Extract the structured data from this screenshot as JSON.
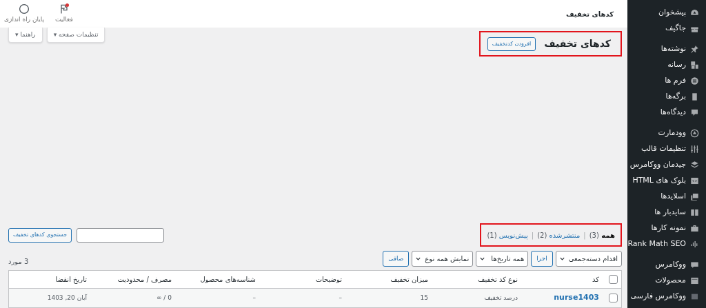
{
  "sidebar": {
    "groups": [
      [
        {
          "label": "پیشخوان"
        },
        {
          "label": "جاگیف"
        }
      ],
      [
        {
          "label": "نوشته‌ها"
        },
        {
          "label": "رسانه"
        },
        {
          "label": "فرم ها"
        },
        {
          "label": "برگه‌ها"
        },
        {
          "label": "دیدگاه‌ها"
        }
      ],
      [
        {
          "label": "وودمارت"
        },
        {
          "label": "تنظیمات قالب"
        },
        {
          "label": "جیدمان ووکامرس"
        },
        {
          "label": "بلوک های HTML"
        },
        {
          "label": "اسلایدها"
        },
        {
          "label": "سایدبار ها"
        },
        {
          "label": "نمونه کارها"
        },
        {
          "label": "Rank Math SEO"
        }
      ],
      [
        {
          "label": "ووکامرس"
        },
        {
          "label": "محصولات"
        },
        {
          "label": "ووکامرس فارسی"
        }
      ]
    ]
  },
  "top_bar": {
    "title": "کدهای تخفیف",
    "actions": [
      {
        "label": "فعالیت",
        "notification": true
      },
      {
        "label": "پایان راه اندازی",
        "notification": false
      }
    ]
  },
  "screen_tabs": [
    {
      "label": "تنظیمات صفحه ▾"
    },
    {
      "label": "راهنما ▾"
    }
  ],
  "heading": {
    "title": "کدهای تخفیف",
    "button": "افرودن کدتخفیف",
    "highlighted": true
  },
  "views": {
    "highlighted": true,
    "separator": "|",
    "items": [
      {
        "label": "همه",
        "count": "(3)",
        "selected": true
      },
      {
        "label": "منتشرشده",
        "count": "(2)",
        "selected": false
      },
      {
        "label": "پیش‌نویس",
        "count": "(1)",
        "selected": false
      }
    ]
  },
  "search": {
    "button": "جستجوی کدهای تخفیف"
  },
  "filters": [
    {
      "kind": "select",
      "label": "اقدام دسته‌جمعی"
    },
    {
      "kind": "button",
      "label": "اجرا"
    },
    {
      "kind": "select",
      "label": "همه تاریخ‌ها"
    },
    {
      "kind": "select",
      "label": "نمایش همه نوع"
    },
    {
      "kind": "button",
      "label": "صافی"
    }
  ],
  "items_count": "3 مورد",
  "table": {
    "select_all": {
      "checked": false
    },
    "columns": [
      "کد",
      "نوع کد تخفیف",
      "میزان تخفیف",
      "توضیحات",
      "شناسه‌های محصول",
      "مصرف / محدودیت",
      "تاریخ انقضا"
    ],
    "rows": [
      {
        "checked": false,
        "cells": [
          "nurse1403",
          "درصد تخفیف",
          "15",
          "–",
          "–",
          "∞ / 0",
          "آبان 20, 1403"
        ]
      }
    ]
  }
}
